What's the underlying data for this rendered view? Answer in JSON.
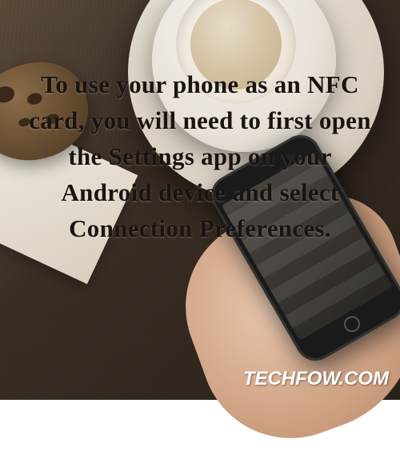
{
  "overlay": {
    "main_text": "To use your phone as an NFC card, you will need to first open the Settings app on your Android device and select Connection Preferences."
  },
  "watermark": {
    "text": "TECHFOW.COM"
  }
}
